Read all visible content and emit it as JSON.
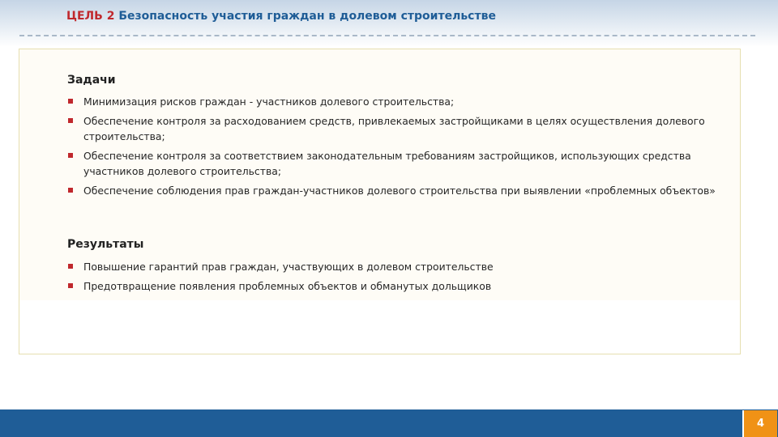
{
  "header": {
    "lead": "ЦЕЛЬ 2",
    "title": "Безопасность участия граждан в долевом строительстве"
  },
  "tasks": {
    "heading": "Задачи",
    "items": [
      "Минимизация рисков граждан - участников долевого строительства;",
      "Обеспечение контроля за расходованием средств, привлекаемых застройщиками в целях осуществления долевого строительства;",
      "Обеспечение контроля за соответствием законодательным требованиям застройщиков, использующих средства участников долевого строительства;",
      "Обеспечение соблюдения прав граждан-участников долевого строительства при выявлении «проблемных объектов»"
    ]
  },
  "results": {
    "heading": "Результаты",
    "items": [
      "Повышение гарантий прав граждан, участвующих в долевом строительстве",
      "Предотвращение появления проблемных объектов и обманутых дольщиков"
    ]
  },
  "footer": {
    "page_number": "4"
  },
  "colors": {
    "accent_red": "#c0282d",
    "brand_blue": "#1f5d97",
    "page_badge_orange": "#f09216"
  },
  "icons": {
    "bullet": "square-bullet-icon"
  }
}
